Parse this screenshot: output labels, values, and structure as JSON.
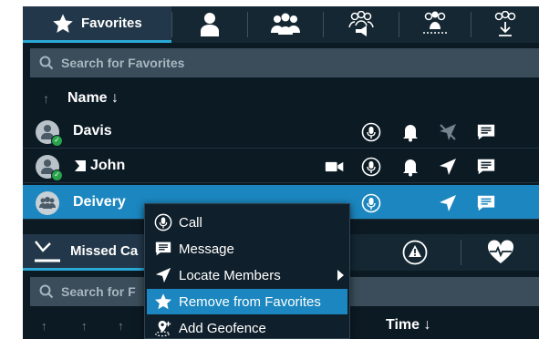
{
  "tabs": {
    "favorites_label": "Favorites"
  },
  "search": {
    "favorites_placeholder": "Search for Favorites",
    "lower_placeholder": "Search for F"
  },
  "list_header": {
    "name": "Name ↓"
  },
  "rows": [
    {
      "name": "Davis",
      "status": "online"
    },
    {
      "name": "John",
      "status": "online"
    },
    {
      "name": "Deivery",
      "selected": true
    }
  ],
  "lower_tabs": {
    "missed_label": "Missed Ca"
  },
  "lower_header": {
    "time": "Time ↓"
  },
  "context_menu": {
    "items": [
      {
        "label": "Call",
        "icon": "mic-icon"
      },
      {
        "label": "Message",
        "icon": "message-icon"
      },
      {
        "label": "Locate Members",
        "icon": "locate-icon",
        "submenu": true
      },
      {
        "label": "Remove from Favorites",
        "icon": "star-icon",
        "highlighted": true
      },
      {
        "label": "Add Geofence",
        "icon": "geofence-icon"
      }
    ]
  },
  "colors": {
    "accent": "#2aa8d6",
    "selected_row": "#1b86bf",
    "background": "#0c1a24"
  }
}
